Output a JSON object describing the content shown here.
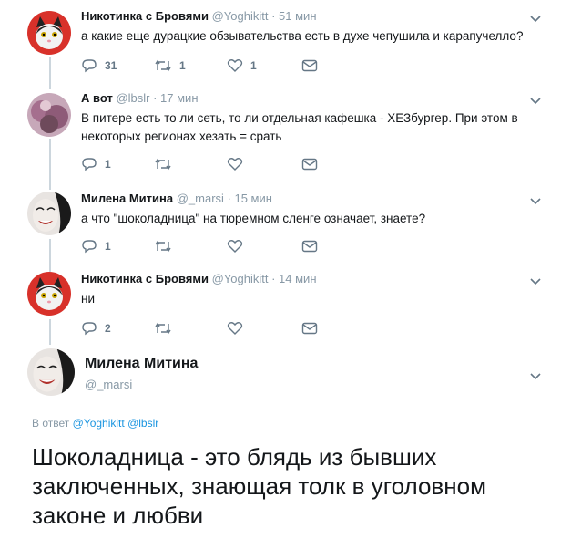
{
  "tweets": [
    {
      "name": "Никотинка с Бровями",
      "handle": "@Yoghikitt",
      "time": "· 51 мин",
      "text": "а какие еще дурацкие обзывательства есть в духе чепушила и карапучелло?",
      "replies": "31",
      "retweets": "1",
      "likes": "1",
      "avatar_icon": "cat-avatar"
    },
    {
      "name": "А вот",
      "handle": "@lbslr",
      "time": "· 17 мин",
      "text": "В питере есть то ли сеть, то ли отдельная кафешка - ХЕЗбургер. При этом в некоторых регионах хезать = срать",
      "replies": "1",
      "retweets": "",
      "likes": "",
      "avatar_icon": "abstract-avatar"
    },
    {
      "name": "Милена Митина",
      "handle": "@_marsi",
      "time": "· 15 мин",
      "text": "а что \"шоколадница\" на тюремном сленге означает, знаете?",
      "replies": "1",
      "retweets": "",
      "likes": "",
      "avatar_icon": "face-avatar"
    },
    {
      "name": "Никотинка с Бровями",
      "handle": "@Yoghikitt",
      "time": "· 14 мин",
      "text": "ни",
      "replies": "2",
      "retweets": "",
      "likes": "",
      "avatar_icon": "cat-avatar"
    }
  ],
  "main_tweet": {
    "name": "Милена Митина",
    "handle": "@_marsi",
    "reply_prefix": "В ответ",
    "reply_to_1": "@Yoghikitt",
    "reply_to_2": "@lbslr",
    "text": "Шоколадница - это блядь из бывших заключенных, знающая толк в уголовном законе и любви"
  },
  "colors": {
    "accent": "#1b95e0",
    "muted": "#8899a6",
    "thread_line": "#ccd6dd",
    "icon": "#657786"
  }
}
